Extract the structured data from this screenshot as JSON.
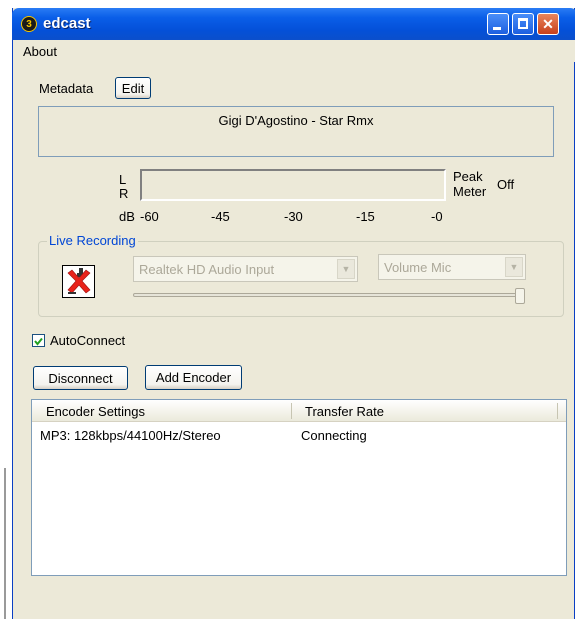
{
  "window": {
    "title": "edcast",
    "app_icon_glyph": "3",
    "title_bar_color": "#0450d8",
    "controls": {
      "minimize": "minimize-icon",
      "maximize": "maximize-icon",
      "close": "✕"
    }
  },
  "menu": {
    "about": "About"
  },
  "metadata": {
    "label": "Metadata",
    "edit_button": "Edit",
    "current_track": "Gigi D'Agostino - Star Rmx"
  },
  "meter": {
    "left_channel": "L",
    "right_channel": "R",
    "db_label": "dB",
    "scale": [
      "-60",
      "-45",
      "-30",
      "-15",
      "-0"
    ],
    "peak_line1": "Peak",
    "peak_line2": "Meter",
    "peak_state": "Off"
  },
  "live_recording": {
    "title": "Live Recording",
    "device_icon": "red-x-disabled-icon",
    "input_device": "Realtek HD Audio Input",
    "mixer_line": "Volume Mic",
    "volume_level": 1.0
  },
  "autoconnect": {
    "label": "AutoConnect",
    "checked": true
  },
  "buttons": {
    "disconnect": "Disconnect",
    "add_encoder": "Add Encoder"
  },
  "encoders": {
    "columns": [
      "Encoder Settings",
      "Transfer Rate"
    ],
    "rows": [
      {
        "settings": "MP3: 128kbps/44100Hz/Stereo",
        "rate": "Connecting"
      }
    ]
  }
}
